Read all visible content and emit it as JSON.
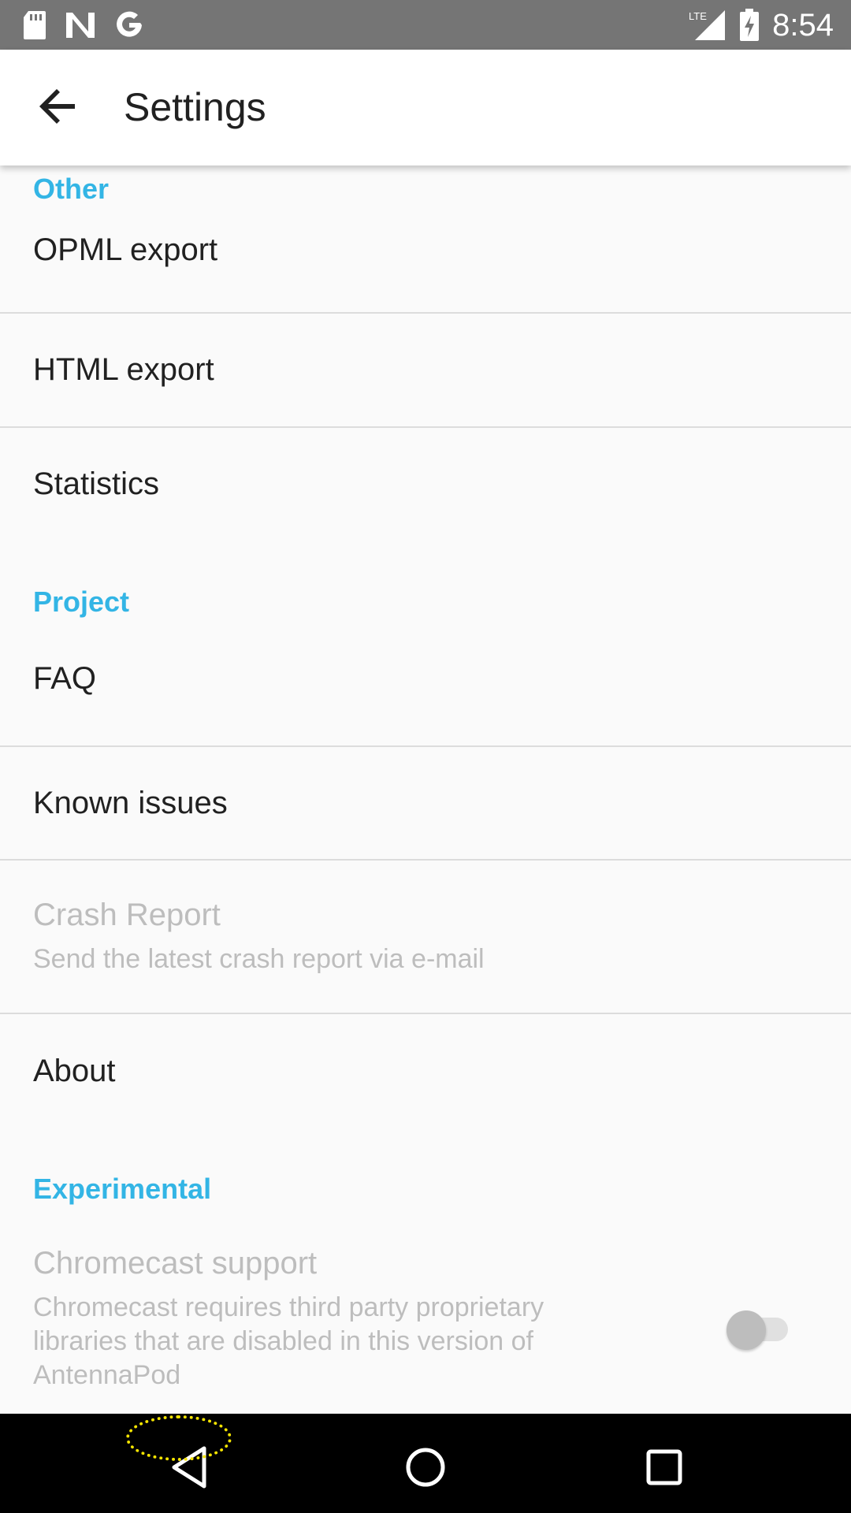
{
  "status_bar": {
    "time": "8:54",
    "network": "LTE",
    "icons_left": [
      "sd-card-icon",
      "n-icon",
      "google-icon"
    ]
  },
  "toolbar": {
    "title": "Settings",
    "back_icon": "arrow-back-icon"
  },
  "sections": {
    "other": {
      "header": "Other",
      "items": {
        "opml": "OPML export",
        "html": "HTML export",
        "statistics": "Statistics"
      }
    },
    "project": {
      "header": "Project",
      "items": {
        "faq": "FAQ",
        "known_issues": "Known issues",
        "crash_report": "Crash Report",
        "crash_report_summary": "Send the latest crash report via e-mail",
        "about": "About"
      }
    },
    "experimental": {
      "header": "Experimental",
      "items": {
        "chromecast": "Chromecast support",
        "chromecast_summary": "Chromecast requires third party proprietary libraries that are disabled in this version of AntennaPod",
        "chromecast_enabled": false
      }
    }
  },
  "nav_bar": {
    "icons": [
      "back-triangle-icon",
      "home-circle-icon",
      "recents-square-icon"
    ]
  },
  "colors": {
    "accent": "#33b5e5",
    "status_bar": "#757575",
    "highlight": "#f5e400"
  }
}
